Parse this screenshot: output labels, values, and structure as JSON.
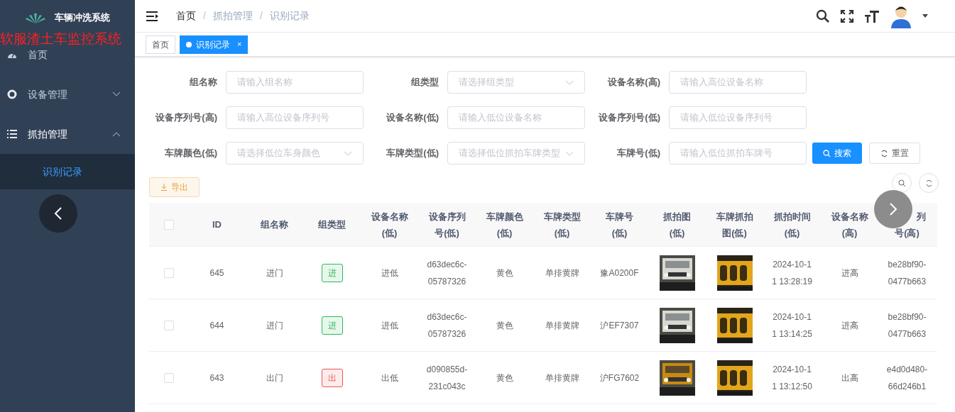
{
  "sidebar": {
    "logo_title": "车辆冲洗系统",
    "overlay_caption": "软服渣土车监控系统",
    "items": [
      {
        "label": "首页",
        "kind": "dashboard",
        "expanded": false
      },
      {
        "label": "设备管理",
        "kind": "device",
        "expanded": false
      },
      {
        "label": "抓拍管理",
        "kind": "list",
        "expanded": true,
        "children": [
          {
            "label": "识别记录",
            "selected": true
          }
        ]
      }
    ]
  },
  "header": {
    "breadcrumbs": [
      "首页",
      "抓拍管理",
      "识别记录"
    ],
    "separator": "/"
  },
  "tags": [
    {
      "label": "首页",
      "selected": false
    },
    {
      "label": "识别记录",
      "selected": true,
      "close": "×"
    }
  ],
  "filters": [
    {
      "label": "组名称",
      "kind": "input",
      "placeholder": "请输入组名称"
    },
    {
      "label": "组类型",
      "kind": "select",
      "placeholder": "请选择组类型"
    },
    {
      "label": "设备名称(高)",
      "kind": "input",
      "placeholder": "请输入高位设备名称"
    },
    {
      "label": "设备序列号(高)",
      "kind": "input",
      "placeholder": "请输入高位设备序列号"
    },
    {
      "label": "设备名称(低)",
      "kind": "input",
      "placeholder": "请输入低位设备名称"
    },
    {
      "label": "设备序列号(低)",
      "kind": "input",
      "placeholder": "请输入低位设备序列号"
    },
    {
      "label": "车牌颜色(低)",
      "kind": "select",
      "placeholder": "请选择低位车身颜色"
    },
    {
      "label": "车牌类型(低)",
      "kind": "select",
      "placeholder": "请选择低位抓拍车牌类型"
    },
    {
      "label": "车牌号(低)",
      "kind": "input",
      "placeholder": "请输入低位抓拍车牌号"
    }
  ],
  "search_button": "搜索",
  "reset_button": "重置",
  "export_button": "导出",
  "table": {
    "header_checked": false,
    "columns": [
      [
        "ID"
      ],
      [
        "组名称"
      ],
      [
        "组类型"
      ],
      [
        "设备名称",
        "(低)"
      ],
      [
        "设备序列",
        "号(低)"
      ],
      [
        "车牌颜色",
        "(低)"
      ],
      [
        "车牌类型",
        "(低)"
      ],
      [
        "车牌号",
        "(低)"
      ],
      [
        "抓拍图",
        "(低)"
      ],
      [
        "车牌抓拍",
        "图(低)"
      ],
      [
        "抓拍时间",
        "(低)"
      ],
      [
        "设备名称",
        "(高)"
      ],
      [
        "列",
        "号(高)"
      ]
    ],
    "rows": [
      {
        "checked": false,
        "id": "645",
        "group": "进门",
        "type": {
          "label": "进",
          "color": "#2fb95a"
        },
        "device_low": "进低",
        "serial_low": "d63dec6c-05787326",
        "plate_color": "黄色",
        "plate_type": "单排黄牌",
        "plate_no": "豫A0200F",
        "time": "2024-10-11 13:28:19",
        "device_high": "进高",
        "serial_high": "be28bf90-0477b663"
      },
      {
        "checked": false,
        "id": "644",
        "group": "进门",
        "type": {
          "label": "进",
          "color": "#2fb95a"
        },
        "device_low": "进低",
        "serial_low": "d63dec6c-05787326",
        "plate_color": "黄色",
        "plate_type": "单排黄牌",
        "plate_no": "沪EF7307",
        "time": "2024-10-11 13:14:25",
        "device_high": "进高",
        "serial_high": "be28bf90-0477b663"
      },
      {
        "checked": false,
        "id": "643",
        "group": "出门",
        "type": {
          "label": "出",
          "color": "#ee5555"
        },
        "device_low": "出低",
        "serial_low": "d090855d-231c043c",
        "plate_color": "黄色",
        "plate_type": "单排黄牌",
        "plate_no": "沪FG7602",
        "time": "2024-10-11 13:12:50",
        "device_high": "出高",
        "serial_high": "e4d0d480-66d246b1"
      }
    ]
  }
}
